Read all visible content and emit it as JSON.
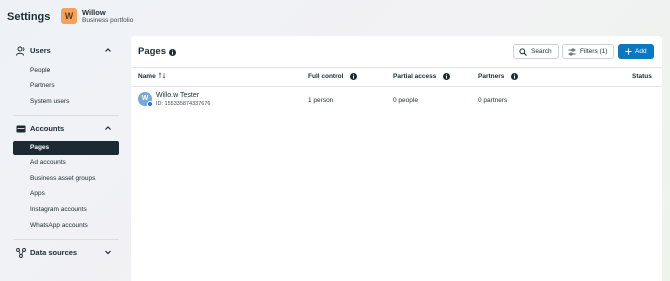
{
  "header": {
    "title": "Settings",
    "business": {
      "avatar_letter": "W",
      "name": "Willow",
      "subtitle": "Business portfolio",
      "avatar_color": "#f4a15e"
    }
  },
  "sidebar": {
    "users": {
      "label": "Users",
      "items": [
        "People",
        "Partners",
        "System users"
      ]
    },
    "accounts": {
      "label": "Accounts",
      "active": "Pages",
      "items": [
        "Ad accounts",
        "Business asset groups",
        "Apps",
        "Instagram accounts",
        "WhatsApp accounts"
      ]
    },
    "data_sources": {
      "label": "Data sources"
    }
  },
  "main": {
    "title": "Pages",
    "buttons": {
      "search": "Search",
      "filters": "Filters (1)",
      "add": "Add"
    },
    "columns": {
      "name": "Name",
      "full_control": "Full control",
      "partial_access": "Partial access",
      "partners": "Partners",
      "status": "Status"
    },
    "rows": [
      {
        "avatar_letter": "W",
        "name": "Willo.w Tester",
        "id": "ID: 155335874337676",
        "full_control": "1 person",
        "partial_access": "0 people",
        "partners": "0 partners"
      }
    ]
  },
  "colors": {
    "accent": "#0a78be",
    "active_nav": "#1c2b33"
  }
}
